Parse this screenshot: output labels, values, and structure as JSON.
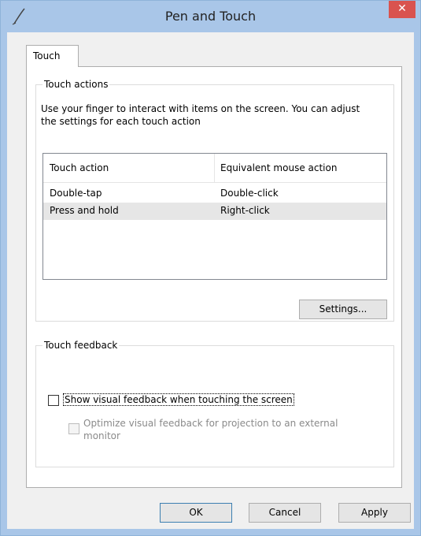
{
  "window": {
    "title": "Pen and Touch",
    "icon": "pen-icon",
    "close_glyph": "✕"
  },
  "tabs": [
    {
      "label": "Touch",
      "selected": true
    }
  ],
  "touch_actions": {
    "group_label": "Touch actions",
    "description": "Use your finger to interact with items on the screen. You can adjust the settings for each touch action",
    "columns": [
      "Touch action",
      "Equivalent mouse action"
    ],
    "rows": [
      {
        "action": "Double-tap",
        "mouse_action": "Double-click"
      },
      {
        "action": "Press and hold",
        "mouse_action": "Right-click"
      }
    ],
    "selected_row": 1,
    "settings_button": "Settings..."
  },
  "touch_feedback": {
    "group_label": "Touch feedback",
    "show_visual_feedback": {
      "label": "Show visual feedback when touching the screen",
      "checked": false
    },
    "optimize_projection": {
      "label_line1": "Optimize visual feedback for projection to an external",
      "label_line2": "monitor",
      "checked": false,
      "enabled": false
    }
  },
  "footer": {
    "ok": "OK",
    "cancel": "Cancel",
    "apply": "Apply"
  },
  "colors": {
    "titlebar": "#a9c6e8",
    "close_button": "#d9534f",
    "selected_row": "#e6e6e6",
    "default_button_border": "#3c7fb1"
  }
}
